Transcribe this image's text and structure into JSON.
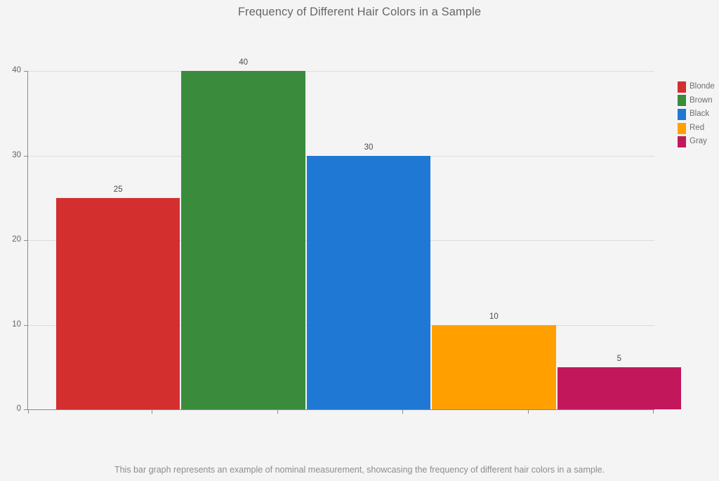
{
  "chart_data": {
    "type": "bar",
    "title": "Frequency of Different Hair Colors in a Sample",
    "xlabel": "",
    "ylabel": "",
    "categories": [
      "Blonde",
      "Brown",
      "Black",
      "Red",
      "Gray"
    ],
    "values": [
      25,
      40,
      30,
      10,
      5
    ],
    "value_labels": [
      "25",
      "40",
      "30",
      "10",
      "5"
    ],
    "colors": [
      "#d32f2f",
      "#3a8c3c",
      "#1f78d4",
      "#ffa000",
      "#c2185b"
    ],
    "ylim": [
      0,
      40
    ],
    "yticks": [
      0,
      10,
      20,
      30,
      40
    ],
    "ytick_labels": [
      "0",
      "10",
      "20",
      "30",
      "40"
    ],
    "grid": true,
    "legend_position": "right",
    "series": [
      {
        "name": "Blonde",
        "values": [
          25
        ],
        "color": "#d32f2f"
      },
      {
        "name": "Brown",
        "values": [
          40
        ],
        "color": "#3a8c3c"
      },
      {
        "name": "Black",
        "values": [
          30
        ],
        "color": "#1f78d4"
      },
      {
        "name": "Red",
        "values": [
          10
        ],
        "color": "#ffa000"
      },
      {
        "name": "Gray",
        "values": [
          5
        ],
        "color": "#c2185b"
      }
    ]
  },
  "legend": {
    "items": [
      {
        "label": "Blonde",
        "color": "#d32f2f"
      },
      {
        "label": "Brown",
        "color": "#3a8c3c"
      },
      {
        "label": "Black",
        "color": "#1f78d4"
      },
      {
        "label": "Red",
        "color": "#ffa000"
      },
      {
        "label": "Gray",
        "color": "#c2185b"
      }
    ]
  },
  "caption": {
    "text": "This bar graph represents an example of nominal measurement, showcasing the frequency of different hair colors in a sample."
  },
  "theme": {
    "background": "#f4f4f4",
    "grid_color": "#dcdcdc",
    "axis_color": "#8a8a8a",
    "title_color": "#65676b",
    "tick_color": "#5f6368",
    "caption_color": "#8b8d90"
  }
}
